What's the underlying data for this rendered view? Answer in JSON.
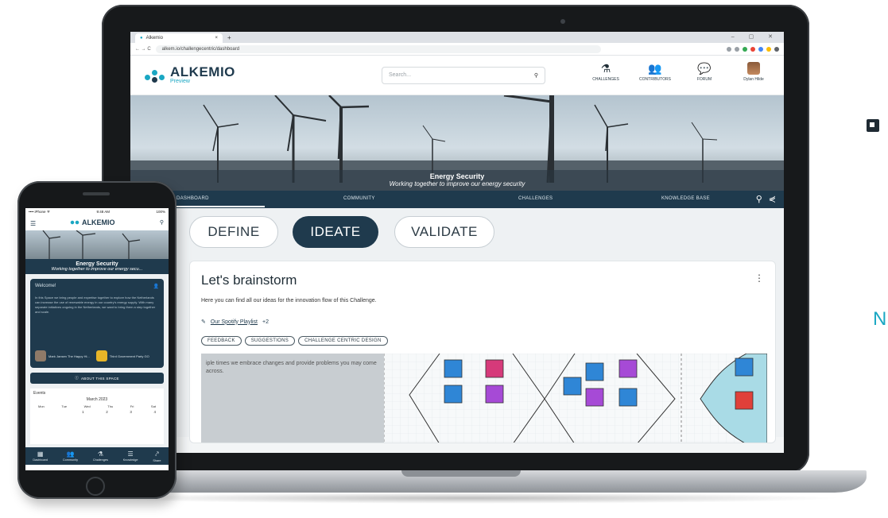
{
  "browser": {
    "tab_title": "Alkemio",
    "tab_close": "×",
    "new_tab": "+",
    "window_controls": "– ▢ ✕",
    "nav_buttons": "← → C",
    "url": "alkem.io/challengecentric/dashboard"
  },
  "app": {
    "logo_text": "ALKEMIO",
    "logo_sub": "Preview",
    "search_placeholder": "Search...",
    "nav": [
      {
        "label": "CHALLENGES",
        "glyph": "⚗"
      },
      {
        "label": "CONTRIBUTORS",
        "glyph": "👥"
      },
      {
        "label": "FORUM",
        "glyph": "💬"
      },
      {
        "label": "Dylan Hilde"
      }
    ]
  },
  "space": {
    "title": "Energy Security",
    "tagline": "Working together to improve our energy security",
    "tabs": [
      "DASHBOARD",
      "COMMUNITY",
      "CHALLENGES",
      "KNOWLEDGE BASE"
    ]
  },
  "phases": [
    "DEFINE",
    "IDEATE",
    "VALIDATE"
  ],
  "card": {
    "title": "Let's brainstorm",
    "menu": "⋮",
    "description": "Here you can find all our ideas for the innovation flow of this Challenge.",
    "link_label": "Our Spotify Playlist",
    "link_extra": "+2",
    "tags": [
      "FEEDBACK",
      "SUGGESTIONS",
      "CHALLENGE CENTRIC DESIGN"
    ],
    "whiteboard_note": "iple times we embrace changes and provide problems you may come across."
  },
  "phone": {
    "status_left": "•••• iPhone ᯤ",
    "status_time": "9:48 AM",
    "status_right": "100%",
    "logo_text": "ALKEMIO",
    "space_title": "Energy Security",
    "space_tagline": "Working together to improve our energy secu...",
    "welcome_title": "Welcome!",
    "welcome_text": "In this Space we bring people and expertise together to explore how the Netherlands can increase the use of renewable energy in our country's energy supply. With many separate initiatives ongoing in the Netherlands, we want to bring them a step together and scale.",
    "person1": "Mark Jansen\nThe Happy Hi...",
    "person2": "Third Government Party GO",
    "about_label": "ABOUT THIS SPACE",
    "events_title": "Events",
    "month": "March 2023",
    "weekdays": [
      "Mon",
      "Tue",
      "Wed",
      "Thu",
      "Fri",
      "Sat"
    ],
    "days": [
      "",
      "",
      "1",
      "2",
      "3",
      "4"
    ],
    "tabs": [
      {
        "icon": "▦",
        "label": "Dashboard"
      },
      {
        "icon": "👥",
        "label": "Community"
      },
      {
        "icon": "⚗",
        "label": "Challenges"
      },
      {
        "icon": "☰",
        "label": "Knowledge"
      },
      {
        "icon": "⤤",
        "label": "Share"
      }
    ]
  },
  "right_fragment_letter": "N",
  "colors": {
    "brand_navy": "#1f3a4d",
    "brand_teal": "#1aa7c3",
    "note_blue": "#2f86d6",
    "note_pink": "#d63a7a",
    "note_purple": "#a64ad6",
    "note_red": "#e0403a"
  }
}
